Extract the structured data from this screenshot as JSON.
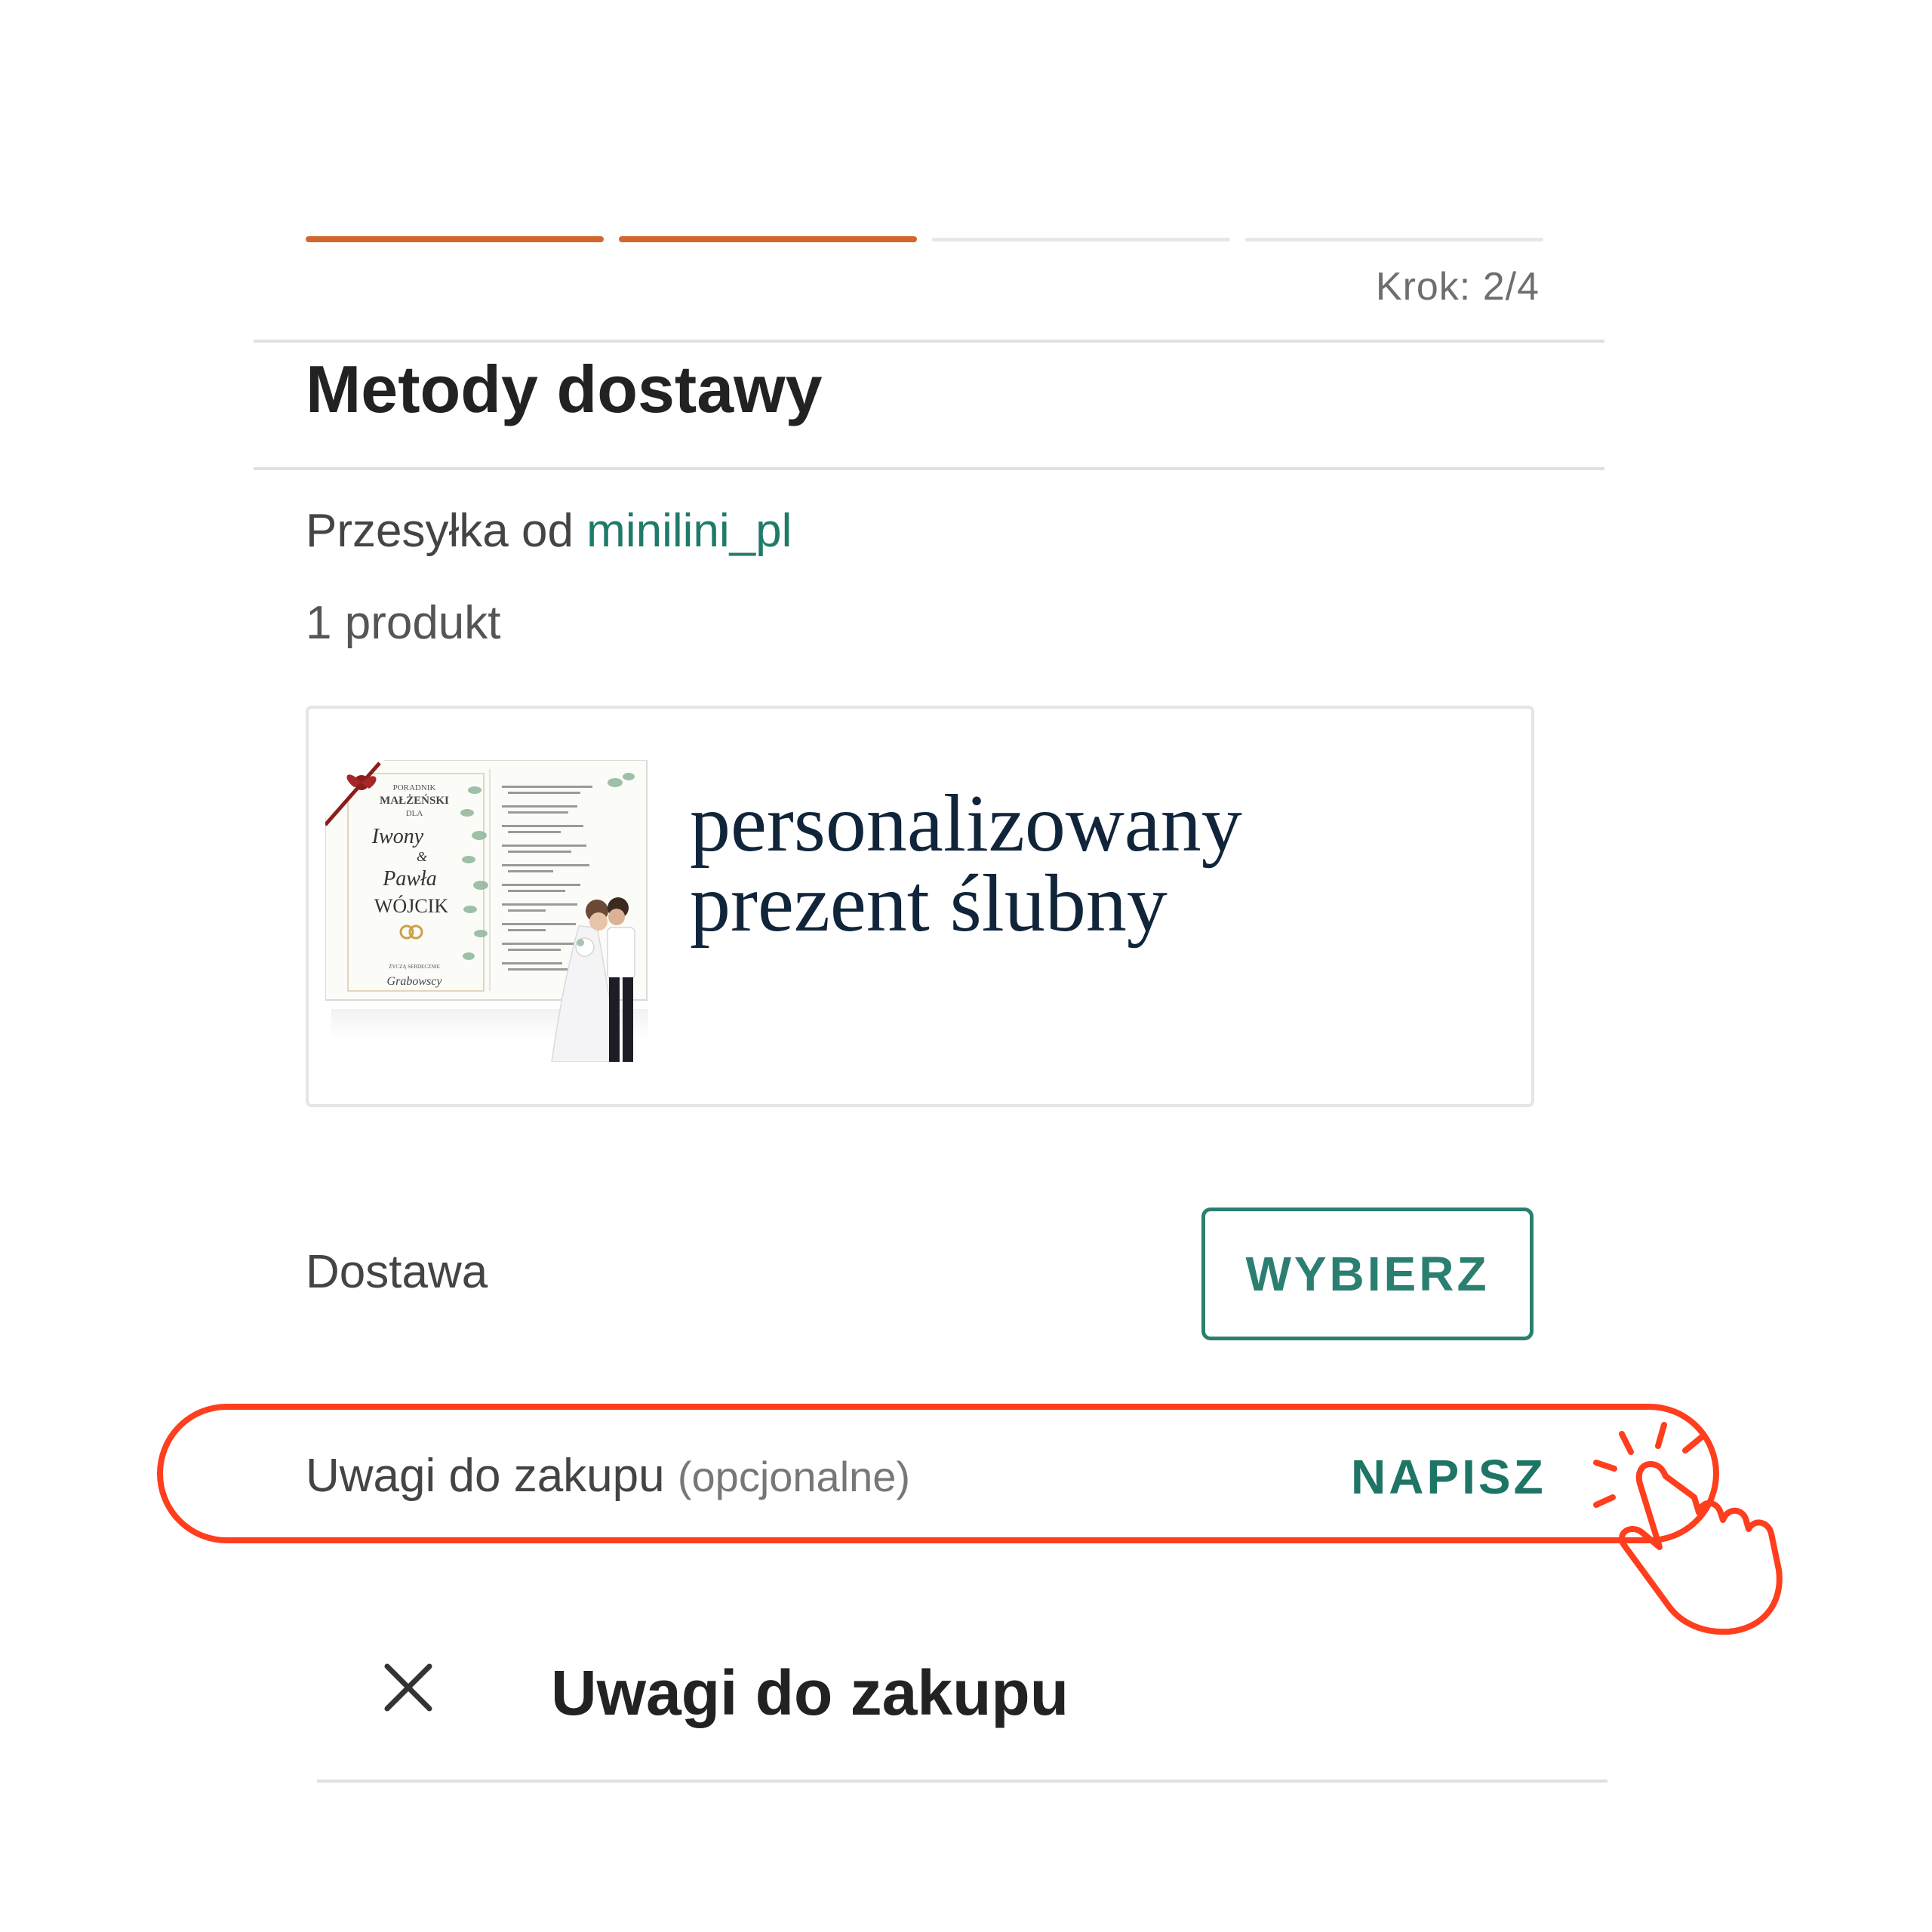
{
  "progress": {
    "total_steps": 4,
    "completed_steps": 2,
    "step_text": "Krok: 2/4"
  },
  "section": {
    "title": "Metody dostawy"
  },
  "shipment": {
    "prefix": "Przesyłka od",
    "seller": "minilini_pl",
    "count": "1 produkt"
  },
  "product": {
    "name_line1": "personalizowany",
    "name_line2": "prezent ślubny",
    "image": {
      "poster_top": "PORADNIK",
      "poster_title": "MAŁŻEŃSKI",
      "poster_for": "DLA",
      "names_script_1": "Iwony",
      "names_amp": "&",
      "names_script_2": "Pawła",
      "surname": "WÓJCIK",
      "footer_small": "ŻYCZĄ SERDECZNIE",
      "footer_script": "Grabowscy"
    }
  },
  "delivery": {
    "label": "Dostawa",
    "button": "WYBIERZ"
  },
  "notes": {
    "label": "Uwagi do zakupu",
    "optional": "(opcjonalne)",
    "action": "NAPISZ"
  },
  "modal": {
    "title": "Uwagi do zakupu",
    "close_icon": "close-icon"
  },
  "colors": {
    "progress_active": "#d2672e",
    "accent_green": "#2a7f70",
    "highlight_red": "#ff3e1e"
  }
}
